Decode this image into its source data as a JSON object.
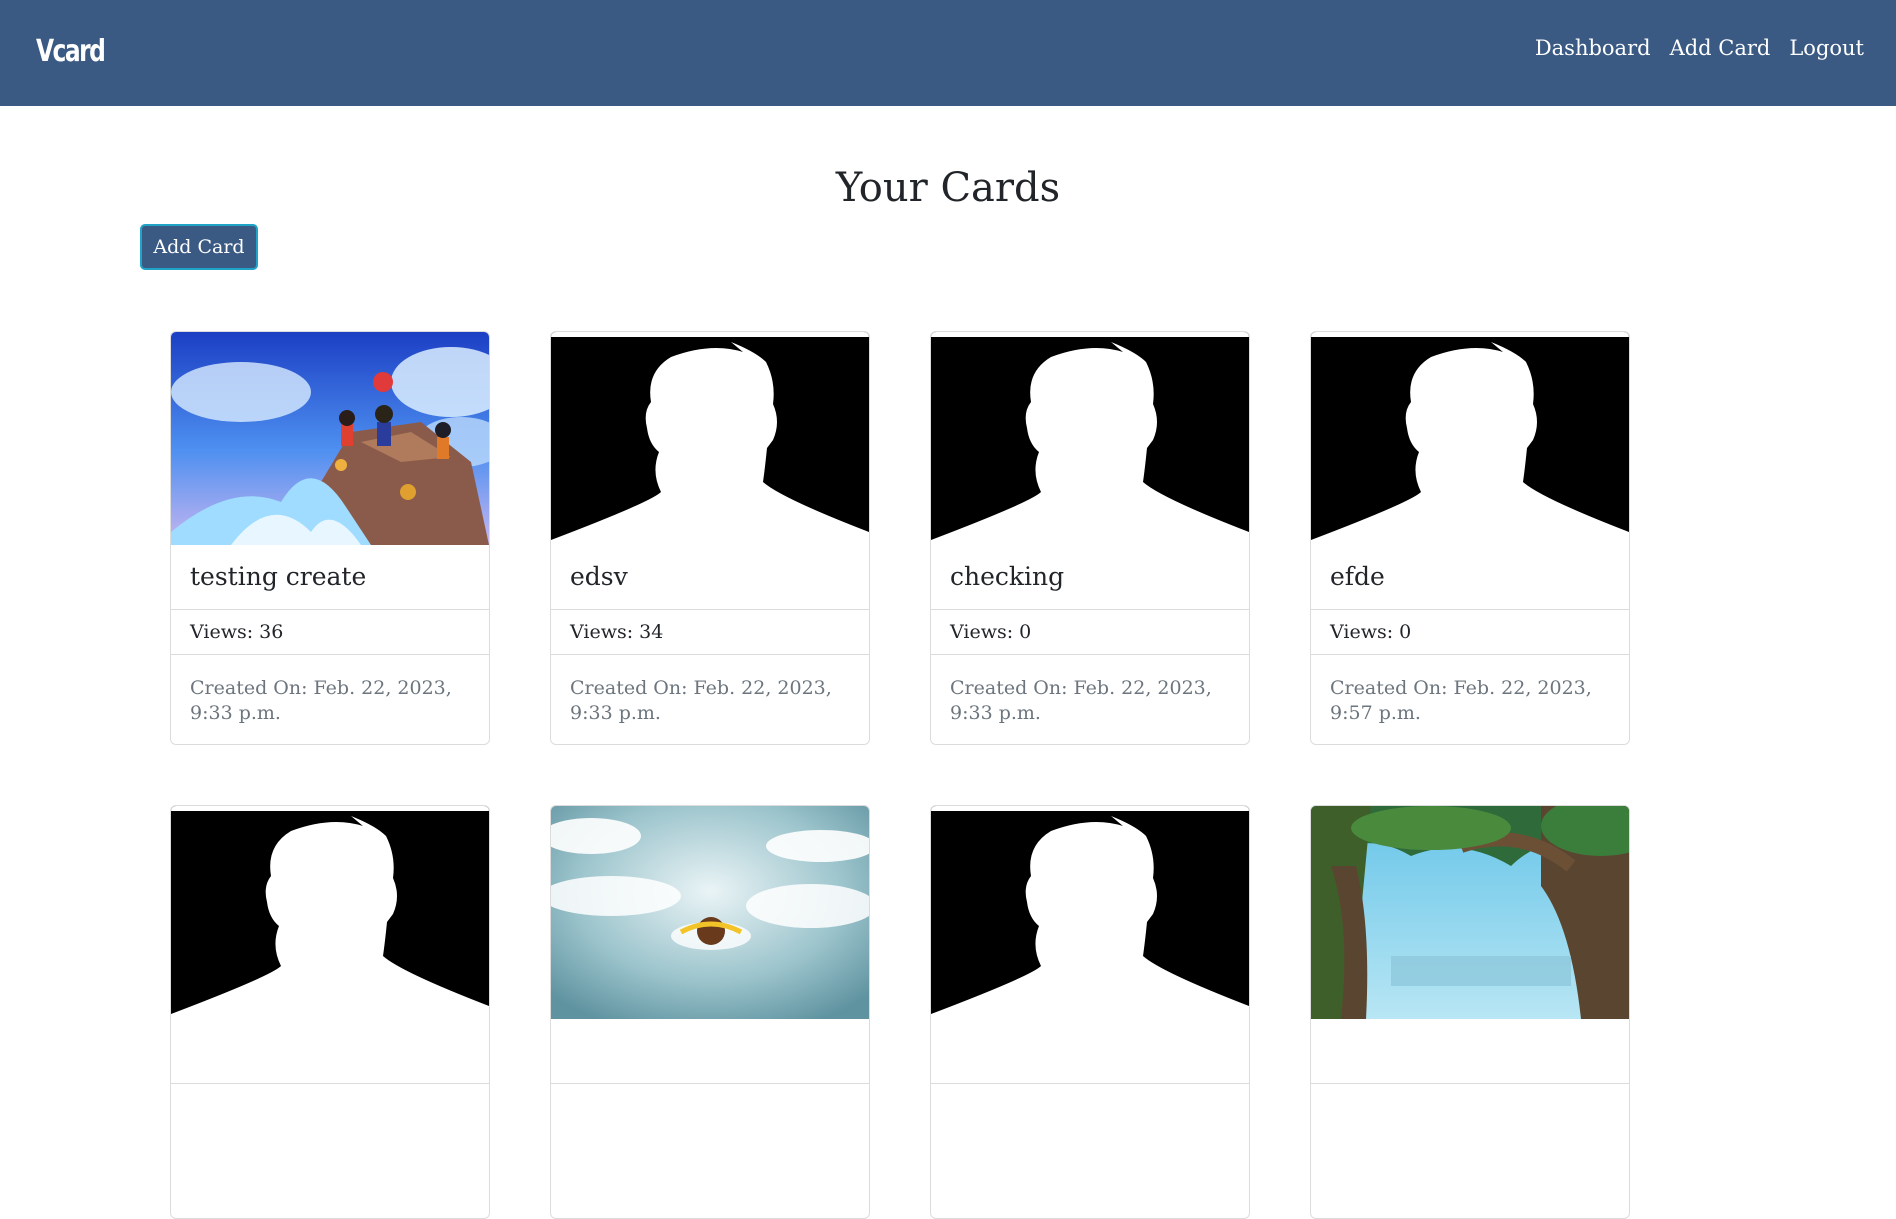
{
  "navbar": {
    "brand": "Vcard",
    "links": [
      "Dashboard",
      "Add Card",
      "Logout"
    ]
  },
  "main": {
    "title": "Your Cards",
    "add_button": "Add Card"
  },
  "cards": [
    {
      "name": "testing create",
      "views": "Views: 36",
      "created": "Created On: Feb. 22, 2023, 9:33 p.m.",
      "image": "anime-beach"
    },
    {
      "name": "edsv",
      "views": "Views: 34",
      "created": "Created On: Feb. 22, 2023, 9:33 p.m.",
      "image": "silhouette"
    },
    {
      "name": "checking",
      "views": "Views: 0",
      "created": "Created On: Feb. 22, 2023, 9:33 p.m.",
      "image": "silhouette"
    },
    {
      "name": "efde",
      "views": "Views: 0",
      "created": "Created On: Feb. 22, 2023, 9:57 p.m.",
      "image": "silhouette"
    },
    {
      "name": "",
      "views": "",
      "created": "",
      "image": "silhouette"
    },
    {
      "name": "",
      "views": "",
      "created": "",
      "image": "sky-clouds"
    },
    {
      "name": "",
      "views": "",
      "created": "",
      "image": "silhouette"
    },
    {
      "name": "",
      "views": "",
      "created": "",
      "image": "forest-tree"
    }
  ],
  "colors": {
    "navbar": "#3a5a84",
    "button_border": "#1fa3c6"
  }
}
